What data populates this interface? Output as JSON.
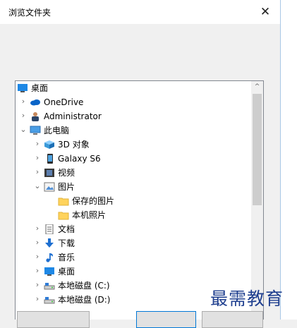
{
  "dialog": {
    "title": "浏览文件夹",
    "close_glyph": "✕"
  },
  "tree": {
    "items": [
      {
        "label": "桌面",
        "icon": "desktop-icon",
        "chevron": "",
        "level": 0
      },
      {
        "label": "OneDrive",
        "icon": "cloud-icon",
        "chevron": "›",
        "level": 1
      },
      {
        "label": "Administrator",
        "icon": "user-icon",
        "chevron": "›",
        "level": 1
      },
      {
        "label": "此电脑",
        "icon": "computer-icon",
        "chevron": "⌄",
        "level": 1
      },
      {
        "label": "3D 对象",
        "icon": "3d-objects-icon",
        "chevron": "›",
        "level": 2
      },
      {
        "label": "Galaxy S6",
        "icon": "phone-icon",
        "chevron": "›",
        "level": 2
      },
      {
        "label": "视频",
        "icon": "video-icon",
        "chevron": "›",
        "level": 2
      },
      {
        "label": "图片",
        "icon": "pictures-icon",
        "chevron": "⌄",
        "level": 2
      },
      {
        "label": "保存的图片",
        "icon": "folder-icon",
        "chevron": "",
        "level": 3
      },
      {
        "label": "本机照片",
        "icon": "folder-icon",
        "chevron": "",
        "level": 3
      },
      {
        "label": "文档",
        "icon": "document-icon",
        "chevron": "›",
        "level": 2
      },
      {
        "label": "下载",
        "icon": "download-icon",
        "chevron": "›",
        "level": 2
      },
      {
        "label": "音乐",
        "icon": "music-icon",
        "chevron": "›",
        "level": 2
      },
      {
        "label": "桌面",
        "icon": "desktop-icon",
        "chevron": "›",
        "level": 2
      },
      {
        "label": "本地磁盘 (C:)",
        "icon": "drive-icon",
        "chevron": "›",
        "level": 2
      },
      {
        "label": "本地磁盘 (D:)",
        "icon": "drive-icon",
        "chevron": "›",
        "level": 2
      }
    ]
  },
  "scrollbar": {
    "up_glyph": "^"
  },
  "watermark": "最需教育",
  "colors": {
    "accent": "#0078d7",
    "selection": "#e5f3ff",
    "watermark": "#1f3f8f"
  }
}
